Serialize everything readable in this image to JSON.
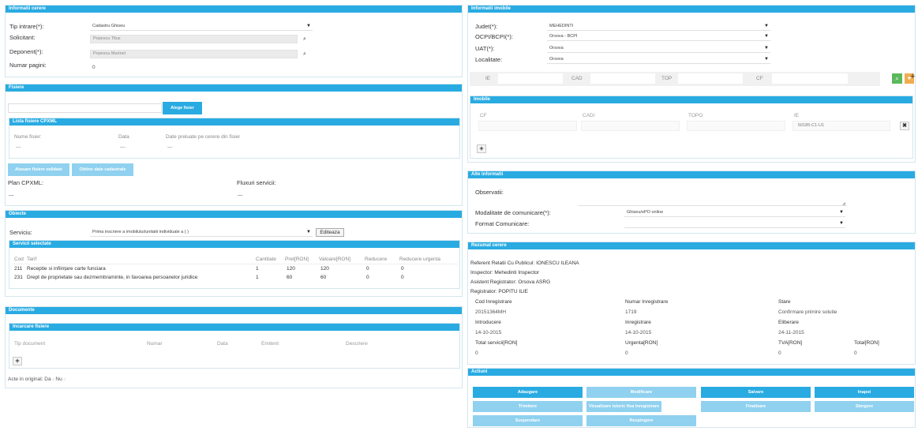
{
  "colors": {
    "accent": "#29abe2",
    "accent_light": "#8fd1ef",
    "green": "#5cb85c",
    "orange": "#f0ad4e"
  },
  "informatii_cerere": {
    "title": "Informatii cerere",
    "tip_intrare_label": "Tip intrare(*):",
    "tip_intrare_value": "Cadastru Ghiseu",
    "solicitant_label": "Solicitant:",
    "solicitant_placeholder": "Popescu Titus",
    "deponent_label": "Deponent(*):",
    "deponent_placeholder": "Popescu Marinel",
    "numar_pagini_label": "Numar pagini:",
    "numar_pagini_value": "0"
  },
  "fisiere": {
    "title": "Fisiere",
    "alege_btn": "Alege fisier",
    "lista_title": "Lista fisiere CPXML",
    "col_nume": "Nume fisier:",
    "col_data": "Data",
    "col_date_preluate": "Date preluate pe cerere din fisier",
    "dash1": "—",
    "dash2": "—",
    "dash3": "—",
    "btn_atasare": "Atasare fisiere validate",
    "btn_obtine": "Obtine date cadastrale",
    "plan_label": "Plan CPXML:",
    "plan_value": "—",
    "fluxuri_label": "Fluxuri servicii:",
    "fluxuri_value": "—"
  },
  "obiecte": {
    "title": "Obiecte",
    "serviciu_label": "Serviciu:",
    "serviciu_value": "Prima inscriere a imobilului/unitatii individuale a ( )",
    "editeaza_btn": "Editeaza",
    "servicii_title": "Servicii selectate",
    "headers": [
      "Cod",
      "Tarif",
      "Cantitate",
      "Pret[RON]",
      "Valoare[RON]",
      "Reducere",
      "Reducere urgenta"
    ],
    "rows": [
      [
        "211",
        "Receptie si inființare carte funciara",
        "1",
        "120",
        "120",
        "0",
        "0"
      ],
      [
        "231",
        "Drept de proprietate sau dezmembraminte, in favoarea persoanelor juridice",
        "1",
        "60",
        "60",
        "0",
        "0"
      ]
    ]
  },
  "documente": {
    "title": "Documente",
    "inc_title": "Incarcare fisiere",
    "headers": [
      "Tip document",
      "Numar",
      "Data",
      "Emitent",
      "Descriere"
    ],
    "acte_label": "Acte in original: Da",
    "acte_nu": "Nu"
  },
  "informatii_imobile": {
    "title": "Informatii imobile",
    "judet_label": "Judet(*):",
    "judet_value": "MEHEDINTI",
    "ocpi_label": "OCPI/BCPI(*):",
    "ocpi_value": "Orsova - BCPI",
    "uat_label": "UAT(*):",
    "uat_value": "Orsova",
    "localitate_label": "Localitate:",
    "localitate_value": "Orsova",
    "ie_label": "IE",
    "cad_label": "CAD",
    "top_label": "TOP",
    "cf_label": "CF",
    "imobile_title": "Imobile",
    "col_cf": "CF",
    "col_cad": "CAD/",
    "col_topo": "TOPO",
    "col_ie": "IE",
    "ie_value": "50185-C1-U1"
  },
  "alte_informatii": {
    "title": "Alte informatii",
    "observatii_label": "Observatii:",
    "modalitate_label": "Modalitate de comunicare(*):",
    "modalitate_value": "Ghiseu/ePO online",
    "format_label": "Format Comunicare:"
  },
  "rezumat": {
    "title": "Rezumat cerere",
    "referent": "Referent Relatii Cu Publicul: IONESCU ILEANA",
    "inspector": "Inspector: Mehedinti Inspector",
    "asistent": "Asistent Registrator: Orsova ASRG",
    "registrator": "Registrator: POPITU ILIE",
    "cod_label": "Cod Inregistrare",
    "cod_value": "20151364MH",
    "nr_label": "Numar Inregistrare",
    "nr_value": "1719",
    "stare_label": "Stare",
    "stare_value": "Confirmare primire solutie",
    "introducere_label": "Introducere",
    "introducere_value": "14-10-2015",
    "inregistrare_label": "Inregistrare",
    "inregistrare_value": "14-10-2015",
    "eliberare_label": "Eliberare",
    "eliberare_value": "24-11-2015",
    "total_servicii_label": "Total servicii[RON]",
    "total_servicii_value": "0",
    "urgenta_label": "Urgenta[RON]",
    "urgenta_value": "0",
    "tva_label": "TVA[RON]",
    "tva_value": "0",
    "total_label": "Total[RON]",
    "total_value": "0"
  },
  "actiuni": {
    "title": "Actiuni",
    "row1": [
      "Adaugare",
      "Modificare",
      "Salvare",
      "Inapoi"
    ],
    "row2": [
      "Trimitere",
      "Vizualizare istoric fisa inregistrare",
      "Finalizare",
      "Stergere"
    ],
    "row3": [
      "Suspendare",
      "Respingere"
    ]
  }
}
